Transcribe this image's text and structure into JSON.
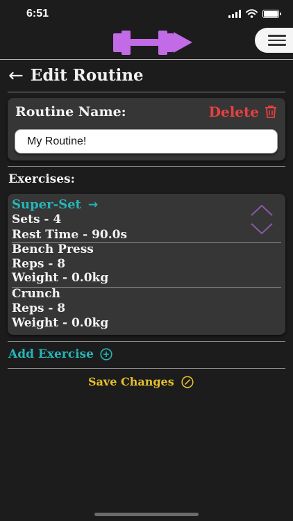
{
  "status_bar": {
    "time": "6:51"
  },
  "header": {
    "logo_icon": "dumbbell-play-logo",
    "menu_icon": "hamburger-icon"
  },
  "page": {
    "title": "Edit Routine",
    "back_icon": "back-arrow-icon"
  },
  "routine": {
    "name_label": "Routine Name:",
    "delete_label": "Delete",
    "delete_icon": "trash-icon",
    "name_value": "My Routine!"
  },
  "exercises": {
    "label": "Exercises:",
    "superset": {
      "title": "Super-Set",
      "title_icon": "arrow-right-icon",
      "sets": "Sets - 4",
      "rest_time": "Rest Time - 90.0s",
      "reorder_icon": "reorder-chevrons-icon",
      "items": [
        {
          "name": "Bench Press",
          "reps": "Reps - 8",
          "weight": "Weight - 0.0kg"
        },
        {
          "name": "Crunch",
          "reps": "Reps - 8",
          "weight": "Weight - 0.0kg"
        }
      ]
    }
  },
  "actions": {
    "add_exercise": "Add Exercise",
    "add_icon": "plus-circle-icon",
    "save_changes": "Save Changes",
    "save_icon": "slash-circle-icon"
  },
  "colors": {
    "background": "#1c1c1c",
    "card": "#363636",
    "accent_teal": "#26b5b8",
    "delete_red": "#e84141",
    "save_yellow": "#e6c02a",
    "logo_purple": "#c36be6"
  }
}
